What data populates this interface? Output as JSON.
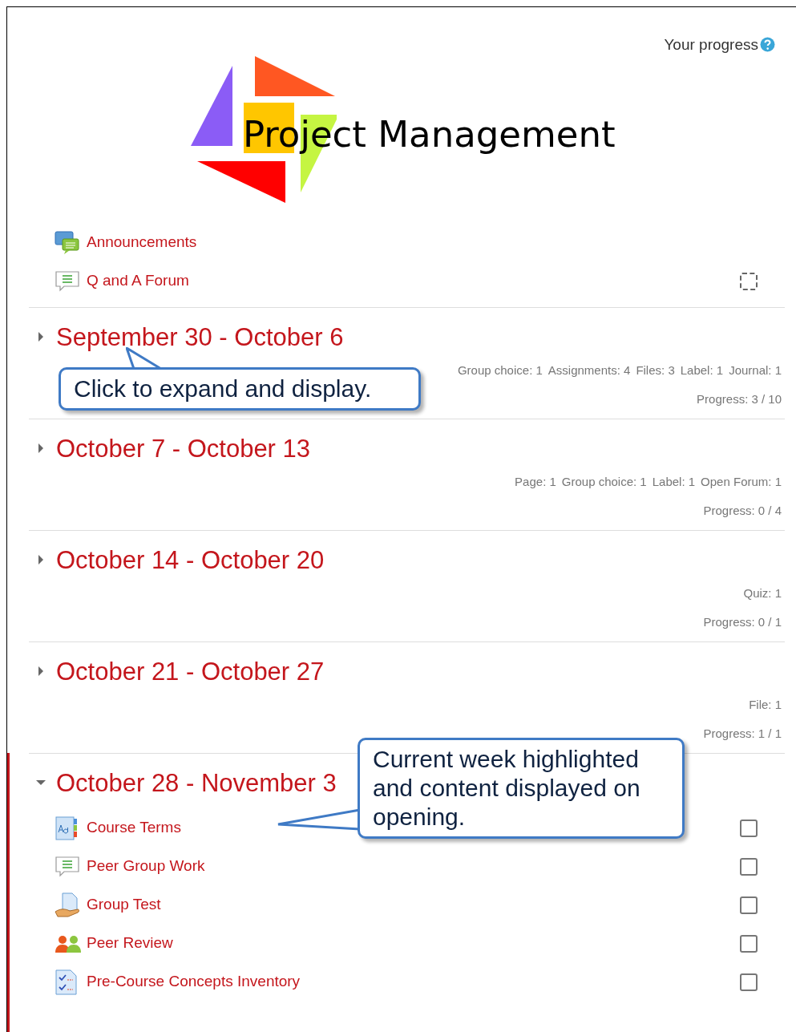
{
  "header": {
    "progress_label": "Your progress",
    "banner_title": "Project Management"
  },
  "top_activities": [
    {
      "name": "Announcements",
      "kind": "news"
    },
    {
      "name": "Q and A Forum",
      "kind": "forum",
      "checkbox": {
        "kind": "auto"
      }
    }
  ],
  "sections": [
    {
      "title": "September 30 - October 6",
      "expanded": false,
      "current": false,
      "summary": [
        "Group choice: 1",
        "Assignments: 4",
        "Files: 3",
        "Label: 1",
        "Journal: 1"
      ],
      "progress": "Progress: 3 / 10"
    },
    {
      "title": "October 7 - October 13",
      "expanded": false,
      "current": false,
      "summary": [
        "Page: 1",
        "Group choice: 1",
        "Label: 1",
        "Open Forum: 1"
      ],
      "progress": "Progress: 0 / 4"
    },
    {
      "title": "October 14 - October 20",
      "expanded": false,
      "current": false,
      "summary": [
        "Quiz: 1"
      ],
      "progress": "Progress: 0 / 1"
    },
    {
      "title": "October 21 - October 27",
      "expanded": false,
      "current": false,
      "summary": [
        "File: 1"
      ],
      "progress": "Progress: 1 / 1"
    },
    {
      "title": "October 28 - November 3",
      "expanded": true,
      "current": true,
      "activities": [
        {
          "name": "Course Terms",
          "kind": "glossary",
          "checkbox": {
            "kind": "manual",
            "checked": false
          }
        },
        {
          "name": "Peer Group Work",
          "kind": "forum",
          "checkbox": {
            "kind": "manual",
            "checked": false
          }
        },
        {
          "name": "Group Test",
          "kind": "assignment",
          "checkbox": {
            "kind": "manual",
            "checked": false
          }
        },
        {
          "name": "Peer Review",
          "kind": "workshop",
          "checkbox": {
            "kind": "manual",
            "checked": false
          }
        },
        {
          "name": "Pre-Course Concepts Inventory",
          "kind": "quiz",
          "checkbox": {
            "kind": "manual",
            "checked": false
          }
        }
      ]
    }
  ],
  "callouts": [
    {
      "text": "Click to expand and display."
    },
    {
      "text": "Current week highlighted and content displayed on opening."
    }
  ]
}
